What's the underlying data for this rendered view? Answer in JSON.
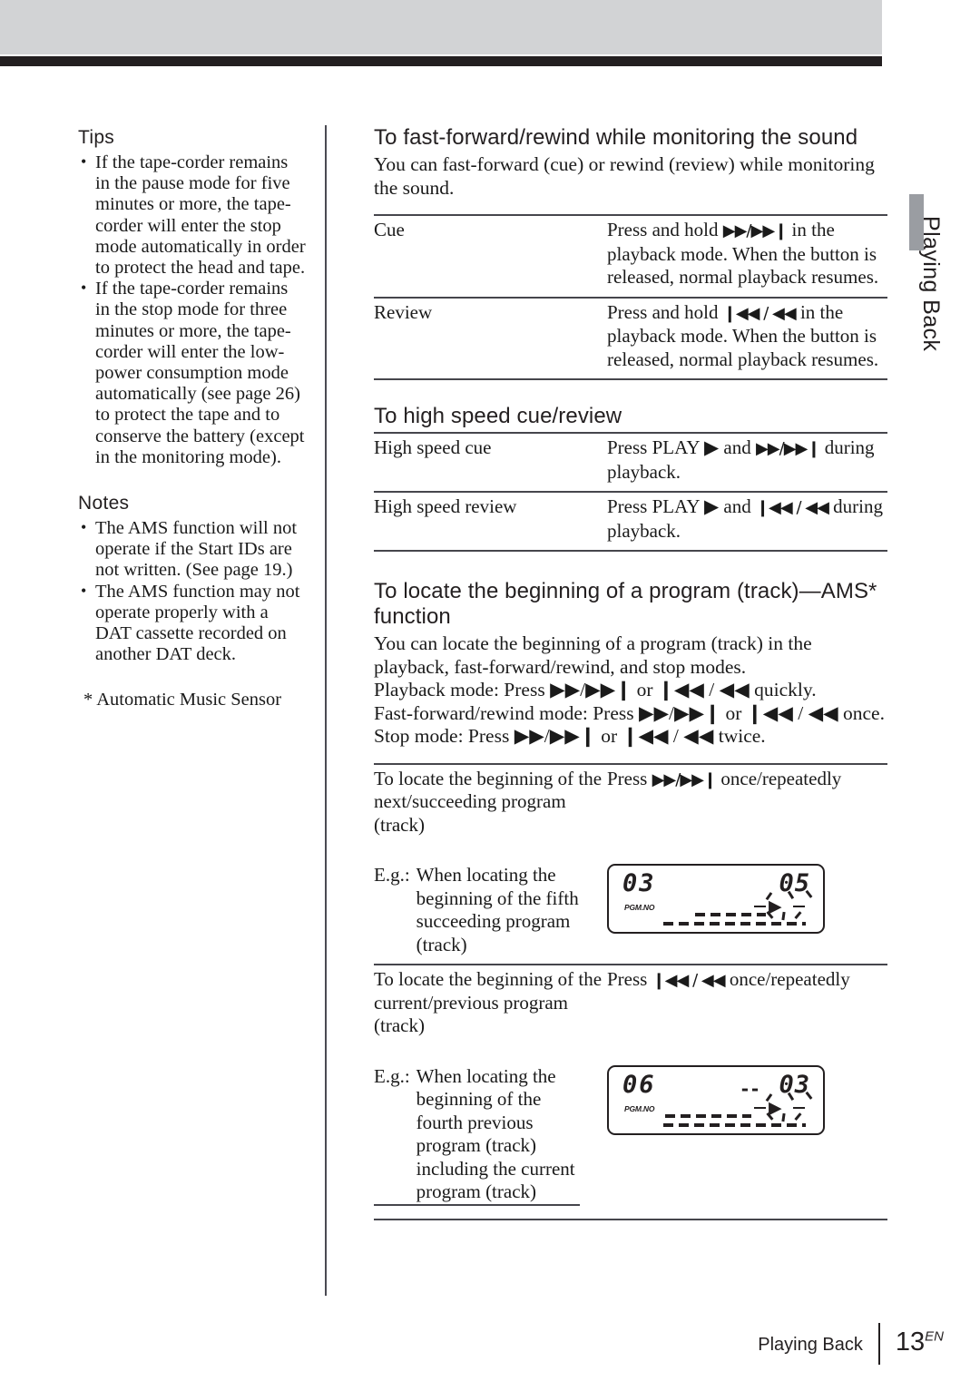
{
  "page": {
    "side_tab": "Playing Back",
    "footer_section": "Playing Back",
    "footer_page": "13",
    "footer_page_sup": "EN"
  },
  "left_column": {
    "tips_heading": "Tips",
    "tips": [
      "If the tape-corder remains in the pause mode for five minutes or more, the tape-corder will enter the stop mode automatically in order to protect the head and tape.",
      "If the tape-corder remains in the stop mode for three minutes or more, the tape-corder will enter the low-power consumption mode automatically (see page 26) to protect the tape and to conserve the battery (except in the monitoring mode)."
    ],
    "notes_heading": "Notes",
    "notes": [
      "The AMS function will not operate if the Start IDs are not written. (See page 19.)",
      "The AMS function may not operate properly with a DAT cassette recorded on another DAT deck."
    ],
    "footnote": "* Automatic Music Sensor",
    "bullet_glyph": "•"
  },
  "right_column": {
    "section1": {
      "heading": "To fast-forward/rewind while monitoring the sound",
      "intro": "You can fast-forward (cue) or rewind (review) while monitoring the sound.",
      "rows": [
        {
          "label": "Cue",
          "text_before": "Press and hold ",
          "symbols": "▶▶/▶▶❙",
          "text_after": " in the playback mode. When the button is released, normal playback resumes."
        },
        {
          "label": "Review",
          "text_before": "Press and hold ",
          "symbols": "❙◀◀ / ◀◀",
          "text_after": " in the playback mode. When the button is released, normal playback resumes."
        }
      ]
    },
    "section2": {
      "heading": "To high speed cue/review",
      "rows": [
        {
          "label": "High speed cue",
          "text_before": "Press PLAY ▶ and ",
          "symbols": "▶▶/▶▶❙",
          "text_after": " during playback."
        },
        {
          "label": "High speed review",
          "text_before": "Press PLAY ▶ and ",
          "symbols": "❙◀◀ / ◀◀",
          "text_after": " during playback."
        }
      ]
    },
    "section3": {
      "heading": "To locate the beginning of a program (track)—AMS* function",
      "intro_line1": "You can locate the beginning of a program (track) in the playback, fast-forward/rewind, and stop modes.",
      "intro_line2": "Playback mode: Press ▶▶/▶▶❙ or ❙◀◀ / ◀◀ quickly.",
      "intro_line3": "Fast-forward/rewind mode: Press ▶▶/▶▶❙ or ❙◀◀ / ◀◀ once.",
      "intro_line4": "Stop mode: Press ▶▶/▶▶❙ or ❙◀◀ / ◀◀ twice.",
      "rows": [
        {
          "label": "To locate the beginning of the next/succeeding program (track)",
          "text_before": "Press ",
          "symbols": "▶▶/▶▶❙",
          "text_after": " once/repeatedly"
        },
        {
          "label": "To locate the beginning of the current/previous program (track)",
          "text_before": "Press ",
          "symbols": "❙◀◀ / ◀◀",
          "text_after": " once/repeatedly"
        }
      ],
      "example1": {
        "eg_label": "E.g.:",
        "eg_text": "When locating the beginning of the fifth succeeding program (track)"
      },
      "example2": {
        "eg_label": "E.g.:",
        "eg_text": "When locating the beginning of the fourth previous program (track) including the current program (track)"
      }
    }
  },
  "lcd_displays": [
    {
      "program_number": "03",
      "program_label": "PGM.NO",
      "track_number": "05",
      "minus_prefix": "",
      "play_symbol": "▶"
    },
    {
      "program_number": "06",
      "program_label": "PGM.NO",
      "track_number": "03",
      "minus_prefix": "--",
      "play_symbol": "▶"
    }
  ],
  "colors": {
    "header_gray": "#d2d3d5",
    "header_black": "#231f20",
    "tab_gray": "#9a9da2",
    "rule": "#46464c",
    "text": "#1a1a1a"
  }
}
